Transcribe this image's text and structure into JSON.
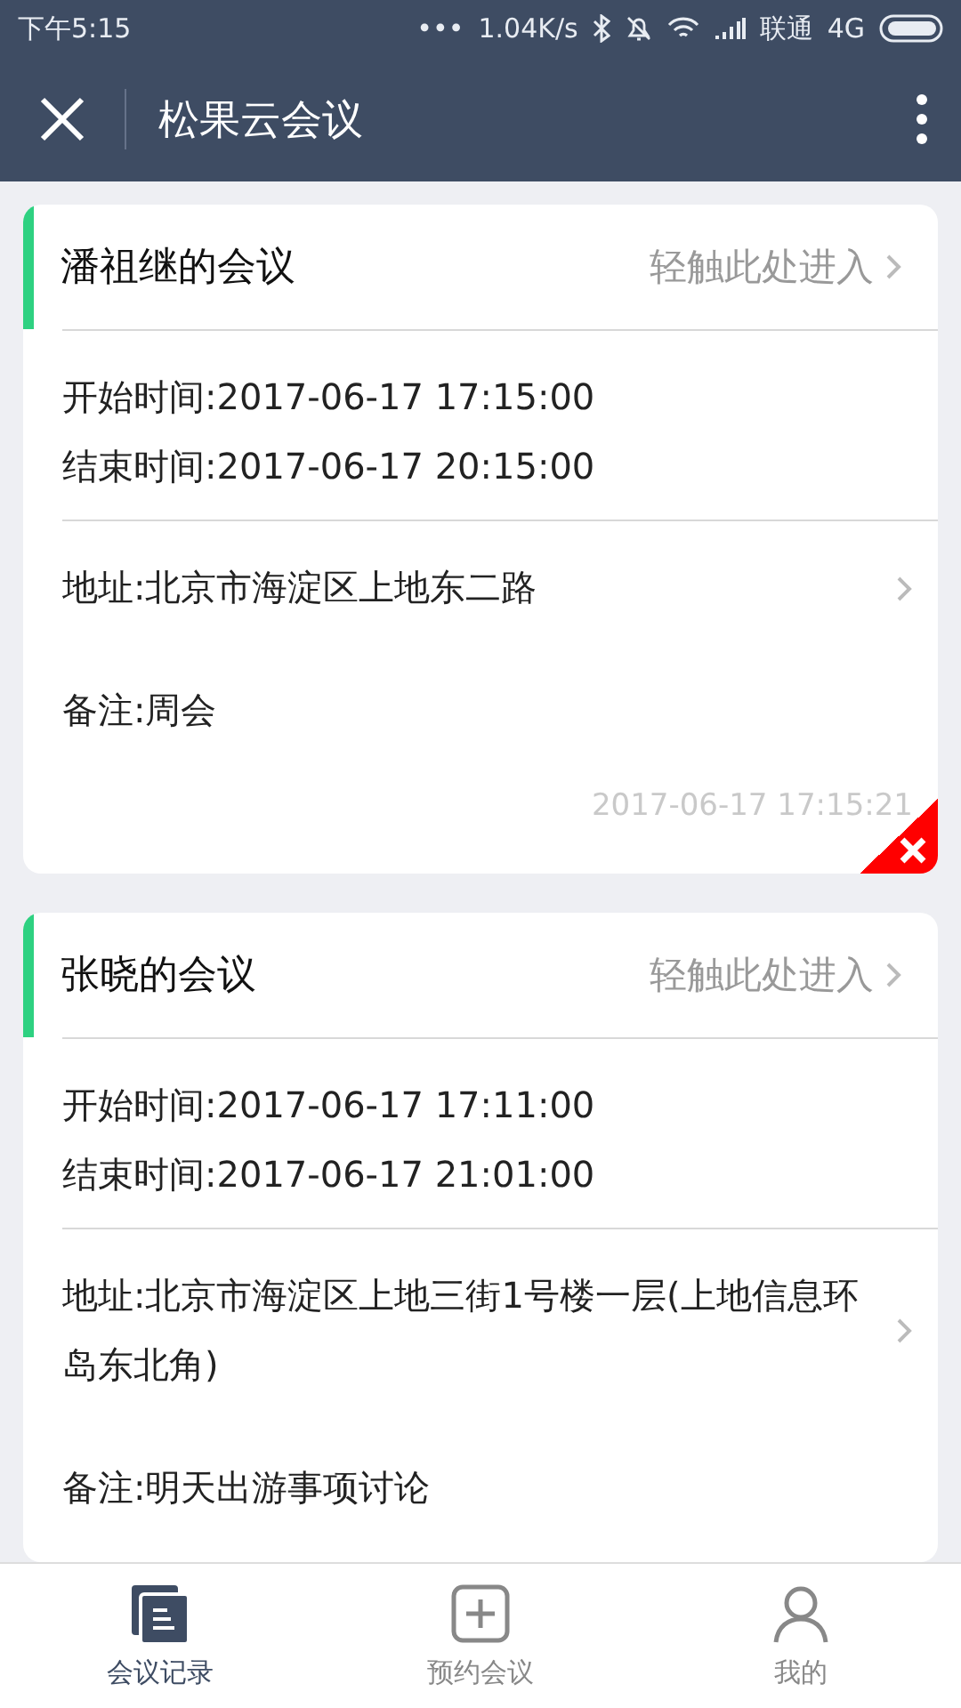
{
  "status_bar": {
    "time": "下午5:15",
    "dots": "•••",
    "speed": "1.04K/s",
    "carrier": "联通",
    "network": "4G"
  },
  "header": {
    "title": "松果云会议"
  },
  "meetings": [
    {
      "title": "潘祖继的会议",
      "enter": "轻触此处进入",
      "start": "开始时间:2017-06-17 17:15:00",
      "end": "结束时间:2017-06-17 20:15:00",
      "address": "地址:北京市海淀区上地东二路",
      "note": "备注:周会",
      "created": "2017-06-17 17:15:21",
      "deletable": true
    },
    {
      "title": "张晓的会议",
      "enter": "轻触此处进入",
      "start": "开始时间:2017-06-17 17:11:00",
      "end": "结束时间:2017-06-17 21:01:00",
      "address": "地址:北京市海淀区上地三街1号楼一层(上地信息环岛东北角)",
      "note": "备注:明天出游事项讨论",
      "deletable": false
    }
  ],
  "tabs": [
    {
      "label": "会议记录",
      "kind": "records",
      "selected": true
    },
    {
      "label": "预约会议",
      "kind": "add",
      "selected": false
    },
    {
      "label": "我的",
      "kind": "profile",
      "selected": false
    }
  ]
}
